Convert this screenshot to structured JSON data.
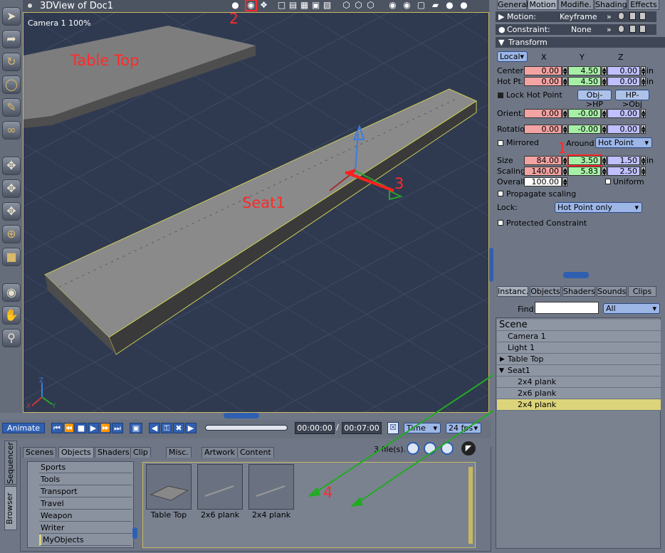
{
  "viewport": {
    "title": "3DView of Doc1",
    "camera_label": "Camera 1 100%",
    "labels": {
      "table_top": "Table Top",
      "seat": "Seat1"
    },
    "annotations": {
      "n1": "1",
      "n2": "2",
      "n3": "3",
      "n4": "4"
    },
    "axis": {
      "x": "X",
      "y": "Y",
      "z": "Z"
    }
  },
  "timeline": {
    "animate_label": "Animate",
    "current_time": "00:00:00",
    "separator": "/",
    "end_time": "00:07:00",
    "time_mode": "Time",
    "fps": "24 fps"
  },
  "library": {
    "side_tabs": [
      "Sequencer",
      "Browser"
    ],
    "tabs": [
      "Scenes",
      "Objects",
      "Shaders",
      "Clip",
      "Misc.",
      "Artwork",
      "Content"
    ],
    "active_tab": "Objects",
    "file_count": "3 file(s).",
    "categories": [
      "Sports",
      "Tools",
      "Transport",
      "Travel",
      "Weapon",
      "Writer",
      "MyObjects"
    ],
    "thumbnails": [
      "Table Top",
      "2x6 plank",
      "2x4 plank"
    ]
  },
  "props": {
    "tabs": [
      "General",
      "Motion",
      "Modifie.",
      "Shading",
      "Effects"
    ],
    "active_tab": "Motion",
    "motion_label": "Motion:",
    "motion_value": "Keyframe",
    "constraint_label": "Constraint:",
    "constraint_value": "None",
    "transform_label": "Transform",
    "space": "Local",
    "cols": [
      "X",
      "Y",
      "Z"
    ],
    "center": {
      "label": "Center",
      "x": "0.00",
      "y": "4.50",
      "z": "0.00",
      "unit": "in"
    },
    "hotpt": {
      "label": "Hot Pt.",
      "x": "0.00",
      "y": "4.50",
      "z": "0.00",
      "unit": "in"
    },
    "lock_hot_point": "Lock Hot Point",
    "obj_hp": "Obj->HP",
    "hp_obj": "HP->Obj",
    "orient": {
      "label": "Orient.",
      "x": "0.00",
      "y": "-0.00",
      "z": "0.00"
    },
    "rotation": {
      "label": "Rotation",
      "x": "0.00",
      "y": "-0.00",
      "z": "0.00"
    },
    "mirrored": "Mirrored",
    "around_label": "Around",
    "around_value": "Hot Point",
    "size": {
      "label": "Size",
      "x": "84.00",
      "y": "3.50",
      "z": "1.50",
      "unit": "in"
    },
    "scaling": {
      "label": "Scaling",
      "x": "140.00",
      "y": "5.83",
      "z": "2.50"
    },
    "overall": {
      "label": "Overall",
      "value": "100.00"
    },
    "uniform": "Uniform",
    "propagate": "Propagate scaling",
    "lock_label": "Lock:",
    "lock_value": "Hot Point only",
    "protected": "Protected Constraint"
  },
  "catalog": {
    "tabs": [
      "Instanc.",
      "Objects",
      "Shaders",
      "Sounds",
      "Clips"
    ],
    "active_tab": "Instanc.",
    "find_label": "Find:",
    "find_value": "",
    "filter": "All",
    "scene_label": "Scene",
    "items": [
      "Camera 1",
      "Light 1",
      "Table Top",
      "Seat1",
      "2x4 plank",
      "2x6 plank",
      "2x4 plank"
    ],
    "selected_index": 6
  },
  "colors": {
    "accent_red": "#ff2a2a",
    "arrow_green": "#22aa22",
    "selection": "#dcd47a"
  }
}
